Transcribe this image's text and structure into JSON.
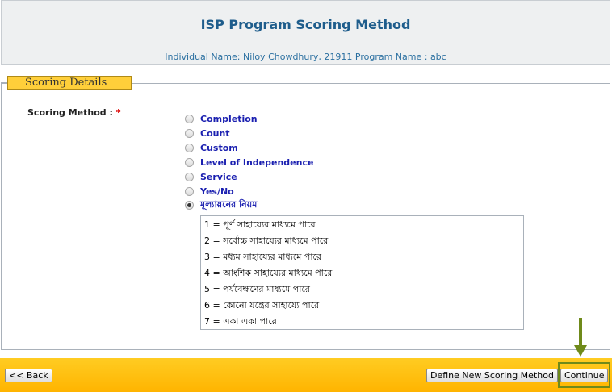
{
  "header": {
    "title": "ISP Program Scoring Method",
    "subtitle": "Individual Name: Niloy Chowdhury, 21911  Program Name : abc"
  },
  "section": {
    "legend": "Scoring Details"
  },
  "form": {
    "scoring_label": "Scoring Method : ",
    "required_marker": "*",
    "options": [
      {
        "label": "Completion",
        "selected": false
      },
      {
        "label": "Count",
        "selected": false
      },
      {
        "label": "Custom",
        "selected": false
      },
      {
        "label": "Level of Independence",
        "selected": false
      },
      {
        "label": "Service",
        "selected": false
      },
      {
        "label": "Yes/No",
        "selected": false
      },
      {
        "label": "মূল্যায়নের নিয়ম",
        "selected": true
      }
    ],
    "scale_items": [
      "1 = পূর্ণ সাহায্যের মাধ্যমে পারে",
      "2 = সর্বোচ্চ সাহায্যের মাধ্যমে পারে",
      "3 = মধ্যম সাহায্যের মাধ্যমে পারে",
      "4 = আংশিক সাহায্যের মাধ্যমে পারে",
      "5 = পর্যবেক্ষণের মাধ্যমে পারে",
      "6 = কোনো যন্ত্রের সাহায্যে পারে",
      "7 = একা একা পারে"
    ]
  },
  "footer": {
    "back_label": "<< Back",
    "define_label": "Define New Scoring Method",
    "continue_label": "Continue"
  },
  "colors": {
    "title": "#1e5d8c",
    "option_label": "#1a1fb0",
    "footer": "#ffbf1a",
    "annotation": "#6f8a1a"
  }
}
